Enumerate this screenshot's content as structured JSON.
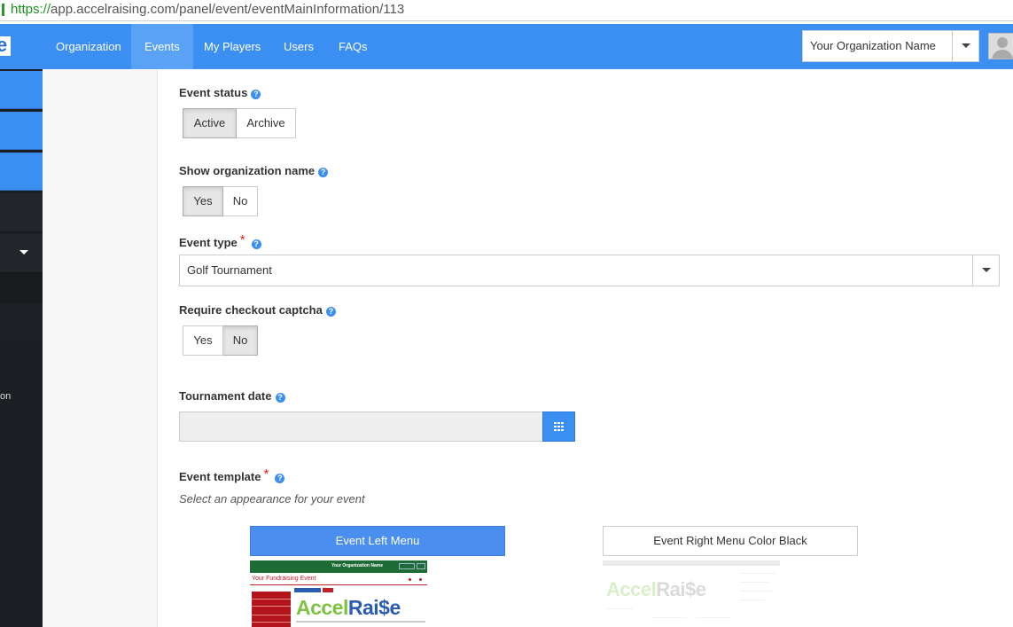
{
  "browser": {
    "url_protocol": "https://",
    "url_rest": "app.accelraising.com/panel/event/eventMainInformation/113"
  },
  "brand": {
    "letter": "e"
  },
  "nav": {
    "items": [
      {
        "label": "Organization"
      },
      {
        "label": "Events",
        "active": true
      },
      {
        "label": "My Players"
      },
      {
        "label": "Users"
      },
      {
        "label": "FAQs"
      }
    ],
    "org_select": "Your Organization Name"
  },
  "sidebar": {
    "partial_text": "on"
  },
  "form": {
    "event_status": {
      "label": "Event status",
      "options": [
        "Active",
        "Archive"
      ],
      "selected": "Active"
    },
    "show_org_name": {
      "label": "Show organization name",
      "options": [
        "Yes",
        "No"
      ],
      "selected": "Yes"
    },
    "event_type": {
      "label": "Event type",
      "required_mark": "*",
      "value": "Golf Tournament"
    },
    "require_captcha": {
      "label": "Require checkout captcha",
      "options": [
        "Yes",
        "No"
      ],
      "selected": "No"
    },
    "tournament_date": {
      "label": "Tournament date",
      "value": ""
    },
    "event_template": {
      "label": "Event template",
      "required_mark": "*",
      "hint": "Select an appearance for your event",
      "templates": [
        {
          "label": "Event Left Menu",
          "selected": true
        },
        {
          "label": "Event Right Menu Color Black",
          "selected": false
        }
      ]
    }
  },
  "preview_left": {
    "header_title": "Your Organization Name",
    "page_title": "Your Fundraising Event",
    "logo_a": "Accel",
    "logo_b": "Rai$e"
  },
  "preview_right": {
    "logo_a": "Accel",
    "logo_b": "Rai$e"
  },
  "colors": {
    "nav_blue": "#3b8ff2",
    "sidebar_dark": "#1c1f24",
    "required": "#e02020"
  }
}
